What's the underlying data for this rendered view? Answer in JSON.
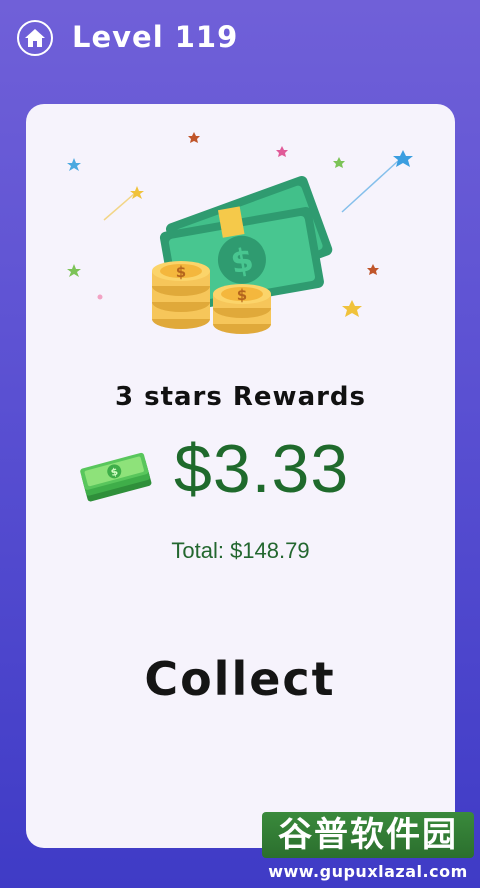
{
  "header": {
    "home_icon": "home-icon",
    "level_title": "Level 119"
  },
  "reward_card": {
    "illustration_icon": "money-bills-and-coins-icon",
    "rewards_label": "3 stars Rewards",
    "cash_icon": "cash-stack-icon",
    "reward_amount": "$3.33",
    "total": "Total: $148.79",
    "collect_label": "Collect"
  },
  "watermark": {
    "title": "谷普软件园",
    "url": "www.gupuxlazal.com"
  },
  "colors": {
    "background_top": "#7060d8",
    "background_bottom": "#3f3bc6",
    "card": "#f6f3fc",
    "amount_green": "#1f6a2c"
  }
}
